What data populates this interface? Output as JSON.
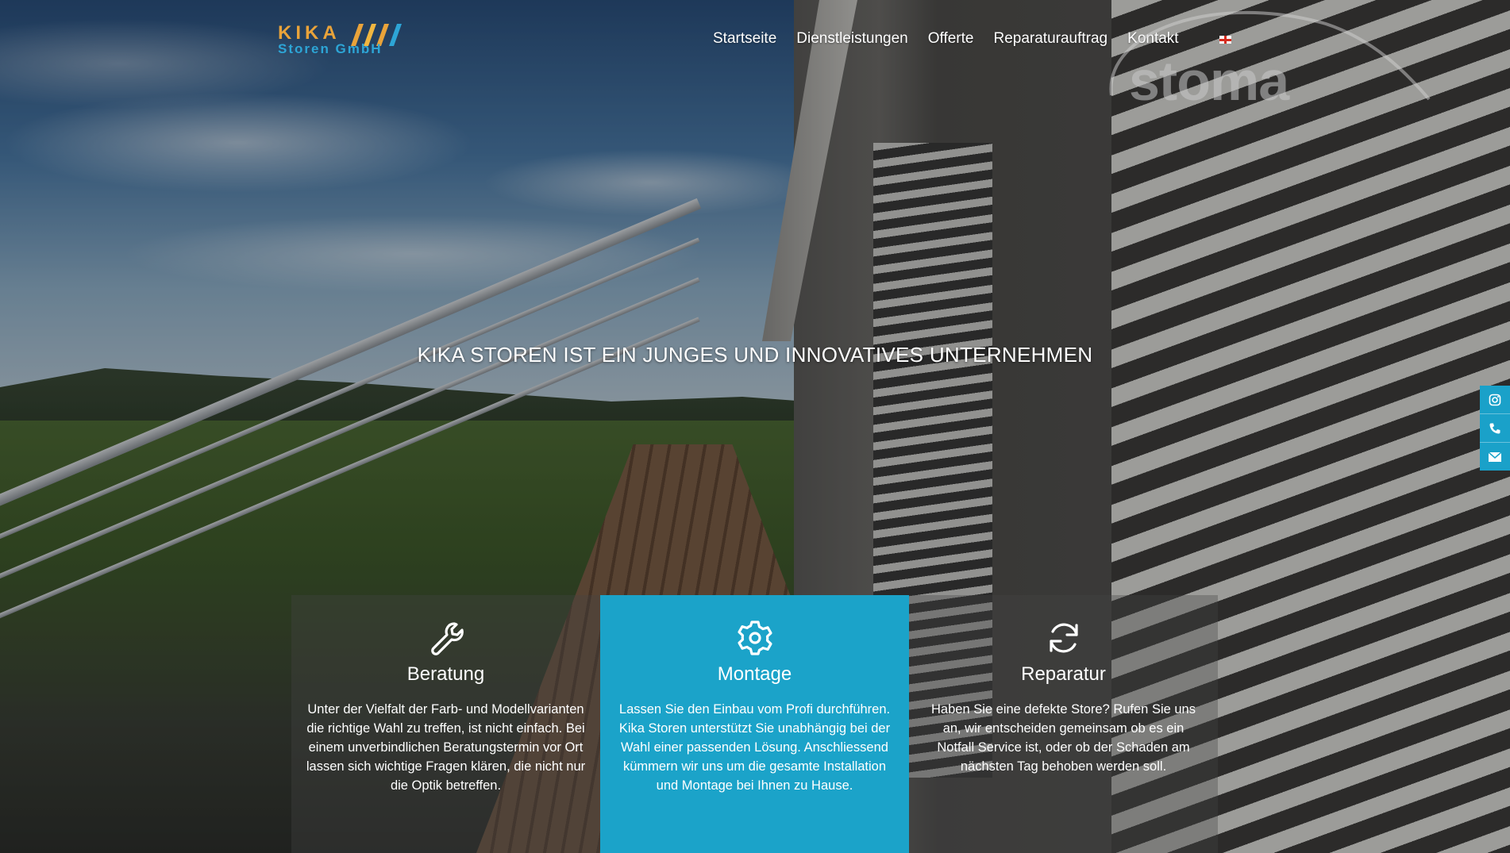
{
  "brand": {
    "logo_line1": "KIKA",
    "logo_line2": "Storen GmbH",
    "watermark": "stoma"
  },
  "nav": {
    "items": [
      "Startseite",
      "Dienstleistungen",
      "Offerte",
      "Reparaturauftrag",
      "Kontakt"
    ],
    "language_flag": "swiss-flag-icon"
  },
  "hero": {
    "title": "KIKA STOREN IST EIN JUNGES UND INNOVATIVES UNTERNEHMEN"
  },
  "social": {
    "icons": [
      "instagram-icon",
      "phone-icon",
      "mail-icon"
    ],
    "color": "#1ba3c9"
  },
  "services": [
    {
      "icon": "wrench-icon",
      "title": "Beratung",
      "text": "Unter der Vielfalt der Farb- und Modellvarianten die richtige Wahl zu treffen, ist nicht einfach. Bei einem unverbindlichen Beratungstermin vor Ort lassen sich wichtige Fragen klären, die nicht nur die Optik betreffen."
    },
    {
      "icon": "gear-icon",
      "title": "Montage",
      "text": "Lassen Sie den Einbau vom Profi durchführen. Kika Storen unterstützt Sie unabhängig bei der Wahl einer passenden Lösung. Anschliessend kümmern wir uns um die gesamte Installation und Montage bei Ihnen zu Hause."
    },
    {
      "icon": "refresh-icon",
      "title": "Reparatur",
      "text": "Haben Sie eine defekte Store? Rufen Sie uns an, wir entscheiden gemeinsam ob es ein Notfall Service ist, oder ob der Schaden am nächsten Tag behoben werden soll."
    }
  ],
  "colors": {
    "accent": "#1ba3c9",
    "logo_orange": "#e9a33a",
    "logo_blue": "#2da5d6"
  }
}
